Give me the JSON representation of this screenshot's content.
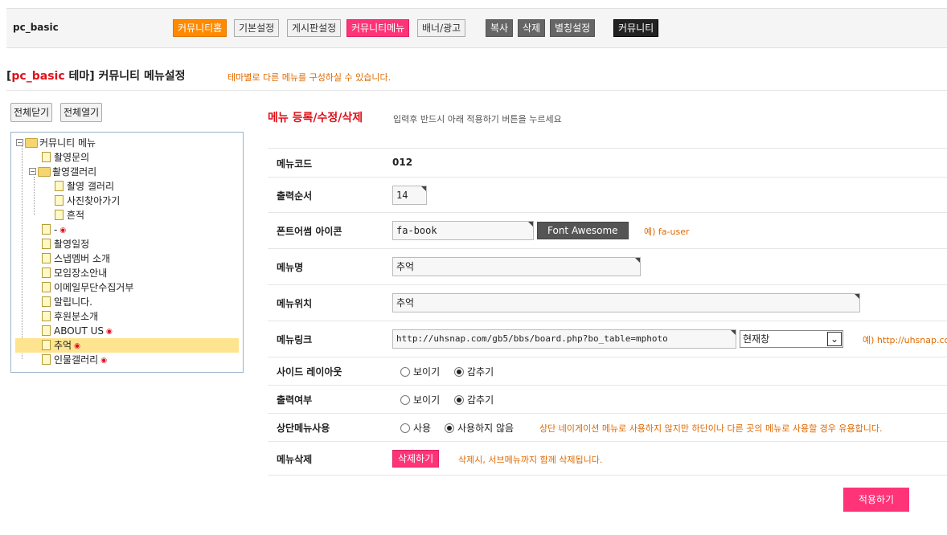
{
  "topbar": {
    "brand": "pc_basic",
    "buttons": [
      "커뮤니티홈",
      "기본설정",
      "게시판설정",
      "커뮤니티메뉴",
      "배너/광고",
      "복사",
      "삭제",
      "별칭설정",
      "커뮤니티"
    ]
  },
  "header": {
    "title_open": "[",
    "title_theme": "pc_basic",
    "title_rest": " 테마] 커뮤니티 메뉴설정",
    "desc": "테마별로 다른 메뉴를 구성하실 수 있습니다."
  },
  "tree": {
    "collapse_all": "전체닫기",
    "expand_all": "전체열기",
    "root": "커뮤니티 메뉴",
    "items": [
      "촬영문의",
      "촬영갤러리",
      "촬영 갤러리",
      "사진찾아가기",
      "흔적",
      "-",
      "촬영일정",
      "스냅멤버 소개",
      "모임장소안내",
      "이메일무단수집거부",
      "알립니다.",
      "후원분소개",
      "ABOUT US",
      "추억",
      "인물갤러리"
    ]
  },
  "form": {
    "title": "메뉴 등록/수정/삭제",
    "desc": "입력후 반드시 아래 적용하기 버튼을 누르세요",
    "code_label": "메뉴코드",
    "code_value": "012",
    "order_label": "출력순서",
    "order_value": "14",
    "icon_label": "폰트어썸 아이콘",
    "icon_value": "fa-book",
    "icon_button": "Font Awesome",
    "icon_hint": "예) fa-user",
    "name_label": "메뉴명",
    "name_value": "추억",
    "position_label": "메뉴위치",
    "position_value": "추억",
    "link_label": "메뉴링크",
    "link_value": "http://uhsnap.com/gb5/bbs/board.php?bo_table=mphoto",
    "link_target": "현재창",
    "link_hint": "예) http://uhsnap.co",
    "side_label": "사이드 레이아웃",
    "side_show": "보이기",
    "side_hide": "감추기",
    "output_label": "출력여부",
    "output_show": "보이기",
    "output_hide": "감추기",
    "top_label": "상단메뉴사용",
    "top_use": "사용",
    "top_nouse": "사용하지 않음",
    "top_hint": "상단 네이게이션 메뉴로 사용하지 않지만 하단이나 다른 곳의 메뉴로 사용할 경우 유용합니다.",
    "delete_label": "메뉴삭제",
    "delete_button": "삭제하기",
    "delete_hint": "삭제시, 서브메뉴까지 함께 삭제됩니다.",
    "apply_button": "적용하기"
  }
}
